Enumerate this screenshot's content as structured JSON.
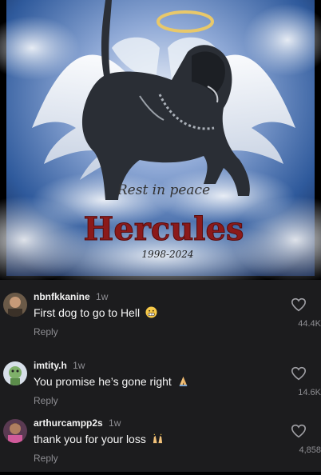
{
  "post_image": {
    "headline": "Rest in peace",
    "name": "Hercules",
    "dates": "1998-2024"
  },
  "comments": [
    {
      "username": "nbnfkkanine",
      "time": "1w",
      "text": "First dog to go to Hell",
      "emoji": "grimacing-face-icon",
      "reply_label": "Reply",
      "likes": "44.4K"
    },
    {
      "username": "imtity.h",
      "time": "1w",
      "text": "You promise he’s gone right",
      "emoji": "folded-hands-icon",
      "reply_label": "Reply",
      "likes": "14.6K"
    },
    {
      "username": "arthurcampp2s",
      "time": "1w",
      "text": "thank you for your loss",
      "emoji": "raised-hands-icon",
      "reply_label": "Reply",
      "likes": "4,858"
    }
  ],
  "colors": {
    "panel": "#1c1c1e",
    "muted": "#8e8e93",
    "title_red": "#8b1a1a",
    "sky": "#2f5a9c"
  }
}
